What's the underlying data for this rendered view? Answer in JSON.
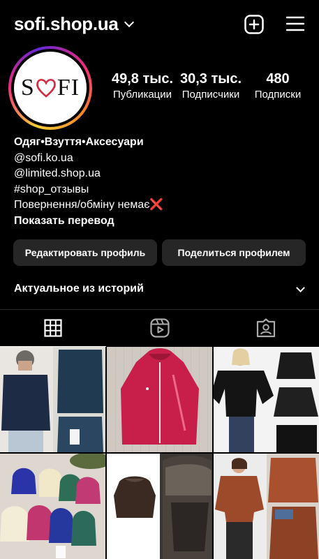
{
  "header": {
    "username": "sofi.shop.ua",
    "icons": [
      "chevron-down-icon",
      "new-post-icon",
      "menu-icon"
    ]
  },
  "profile": {
    "logo_text_left": "S",
    "logo_text_right": "FI",
    "stats": [
      {
        "value": "49,8 тыс.",
        "label": "Публикации"
      },
      {
        "value": "30,3 тыс.",
        "label": "Подписчики"
      },
      {
        "value": "480",
        "label": "Подписки"
      }
    ],
    "bio": {
      "title": "Одяг•Взуття•Аксесуари",
      "lines": [
        "@sofi.ko.ua",
        "@limited.shop.ua",
        "#shop_отзывы",
        "Повернення/обміну немає❌"
      ],
      "translate": "Показать перевод"
    }
  },
  "actions": {
    "edit": "Редактировать профиль",
    "share": "Поделиться профилем"
  },
  "highlights": {
    "label": "Актуальное из историй"
  },
  "tabs": [
    "grid-icon",
    "reels-icon",
    "tagged-icon"
  ],
  "colors": {
    "background": "#000000",
    "button": "#262626",
    "logo_heart": "#d7263d"
  }
}
